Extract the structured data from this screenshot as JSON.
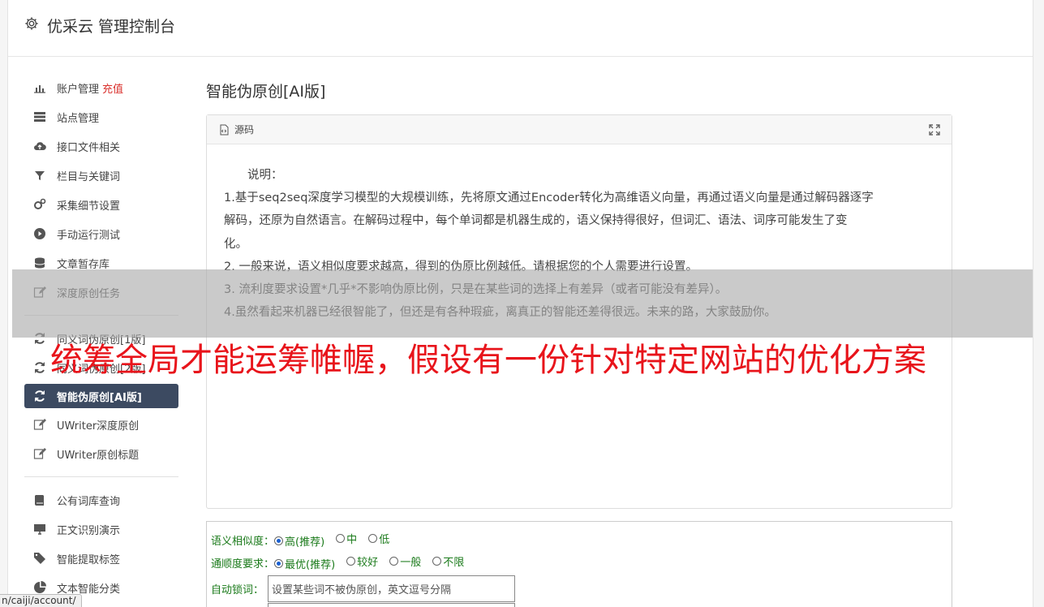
{
  "header": {
    "title": "优采云 管理控制台",
    "icon": "gear-icon"
  },
  "sidebar": {
    "group1": [
      {
        "label": "账户管理",
        "extra": "充值",
        "icon": "bar-chart-icon"
      },
      {
        "label": "站点管理",
        "icon": "server-icon"
      },
      {
        "label": "接口文件相关",
        "icon": "cloud-upload-icon"
      },
      {
        "label": "栏目与关键词",
        "icon": "filter-icon"
      },
      {
        "label": "采集细节设置",
        "icon": "gears-icon"
      },
      {
        "label": "手动运行测试",
        "icon": "play-circle-icon"
      },
      {
        "label": "文章暂存库",
        "icon": "database-icon"
      },
      {
        "label": "深度原创任务",
        "icon": "edit-icon"
      }
    ],
    "group2": [
      {
        "label": "同义词伪原创[1版]",
        "icon": "refresh-icon"
      },
      {
        "label": "同义词伪原创[2版]",
        "icon": "refresh-icon"
      },
      {
        "label": "智能伪原创[AI版]",
        "icon": "refresh-icon",
        "active": true
      },
      {
        "label": "UWriter深度原创",
        "icon": "edit-icon"
      },
      {
        "label": "UWriter原创标题",
        "icon": "edit-icon"
      }
    ],
    "group3": [
      {
        "label": "公有词库查询",
        "icon": "book-icon"
      },
      {
        "label": "正文识别演示",
        "icon": "monitor-icon"
      },
      {
        "label": "智能提取标签",
        "icon": "tag-icon"
      },
      {
        "label": "文本智能分类",
        "icon": "pie-chart-icon"
      }
    ]
  },
  "main": {
    "title": "智能伪原创[AI版]",
    "panel": {
      "head_label": "源码",
      "lines": [
        "　　说明：",
        "1.基于seq2seq深度学习模型的大规模训练，先将原文通过Encoder转化为高维语义向量，再通过语义向量是通过解码器逐字",
        "解码，还原为自然语言。在解码过程中，每个单词都是机器生成的，语义保持得很好，但词汇、语法、词序可能发生了变",
        "化。",
        "2. 一般来说，语义相似度要求越高，得到的伪原比例越低。请根据您的个人需要进行设置。",
        "3. 流利度要求设置*几乎*不影响伪原比例，只是在某些词的选择上有差异（或者可能没有差异）。",
        "4.虽然看起来机器已经很智能了，但还是有各种瑕疵，离真正的智能还差得很远。未来的路，大家鼓励你。"
      ]
    },
    "form": {
      "similarity": {
        "label": "语义相似度：",
        "options": [
          "高(推荐)",
          "中",
          "低"
        ],
        "selected": 0
      },
      "fluency": {
        "label": "通顺度要求：",
        "options": [
          "最优(推荐)",
          "较好",
          "一般",
          "不限"
        ],
        "selected": 0
      },
      "lock": {
        "label": "自动锁词：",
        "placeholder": "设置某些词不被伪原创，英文逗号分隔"
      }
    }
  },
  "overlay_text": "统筹全局才能运筹帷幄，假设有一份针对特定网站的优化方案",
  "status_url": "n/caiji/account/"
}
